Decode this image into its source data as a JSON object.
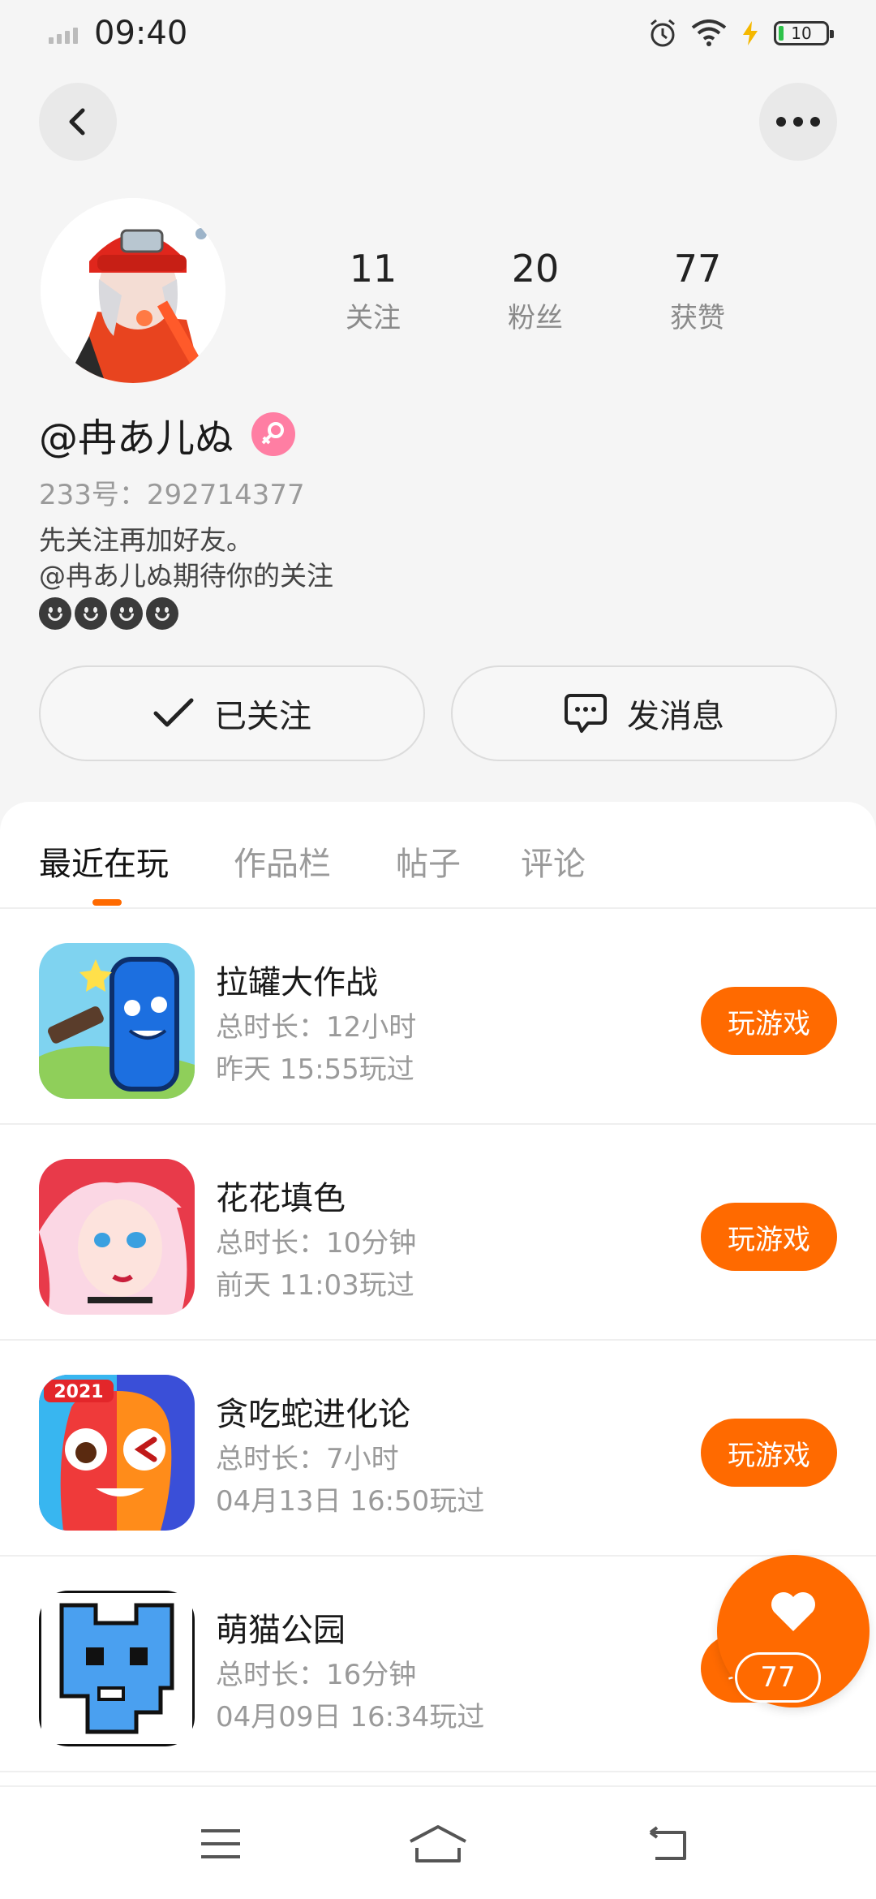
{
  "status_bar": {
    "time": "09:40",
    "battery": "10"
  },
  "profile": {
    "username": "@冉あ儿ぬ",
    "id_text": "233号：292714377",
    "bio_line1": "先关注再加好友。",
    "bio_line2": "@冉あ儿ぬ期待你的关注",
    "stats": [
      {
        "value": "11",
        "label": "关注"
      },
      {
        "value": "20",
        "label": "粉丝"
      },
      {
        "value": "77",
        "label": "获赞"
      }
    ]
  },
  "actions": {
    "follow_label": "已关注",
    "message_label": "发消息"
  },
  "tabs": [
    "最近在玩",
    "作品栏",
    "帖子",
    "评论"
  ],
  "games": [
    {
      "name": "拉罐大作战",
      "duration": "总时长：12小时",
      "last_played": "昨天 15:55玩过",
      "button": "玩游戏"
    },
    {
      "name": "花花填色",
      "duration": "总时长：10分钟",
      "last_played": "前天 11:03玩过",
      "button": "玩游戏"
    },
    {
      "name": "贪吃蛇进化论",
      "duration": "总时长：7小时",
      "last_played": "04月13日 16:50玩过",
      "button": "玩游戏",
      "badge": "2021"
    },
    {
      "name": "萌猫公园",
      "duration": "总时长：16分钟",
      "last_played": "04月09日 16:34玩过",
      "button": "玩游戏"
    }
  ],
  "like": {
    "count": "77"
  },
  "colors": {
    "accent": "#ff6a00",
    "gender_badge": "#ff7ea3"
  }
}
